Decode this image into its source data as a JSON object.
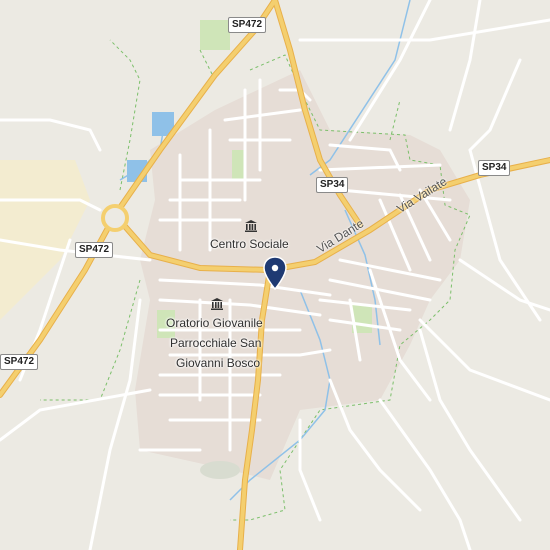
{
  "map": {
    "colors": {
      "land": "#eceae3",
      "urban": "#e6ddd6",
      "major_road": "#f4cf6f",
      "minor_road": "#ffffff",
      "water": "#8fc1e8",
      "park": "#cfe5b8",
      "boundary": "#7bbf6a",
      "pin": "#1f3a73"
    },
    "shields": {
      "sp472_top": "SP472",
      "sp472_left": "SP472",
      "sp472_bottom_left": "SP472",
      "sp34_center": "SP34",
      "sp34_right": "SP34"
    },
    "road_labels": {
      "via_dante": "Via Dante",
      "via_vailate": "Via Vailate"
    },
    "pois": {
      "centro_sociale": {
        "icon": "museum-icon",
        "label": "Centro Sociale"
      },
      "oratorio": {
        "icon": "museum-icon",
        "line1": "Oratorio Giovanile",
        "line2": "Parrocchiale San",
        "line3": "Giovanni Bosco"
      }
    },
    "marker": {
      "icon": "map-pin-icon"
    }
  }
}
